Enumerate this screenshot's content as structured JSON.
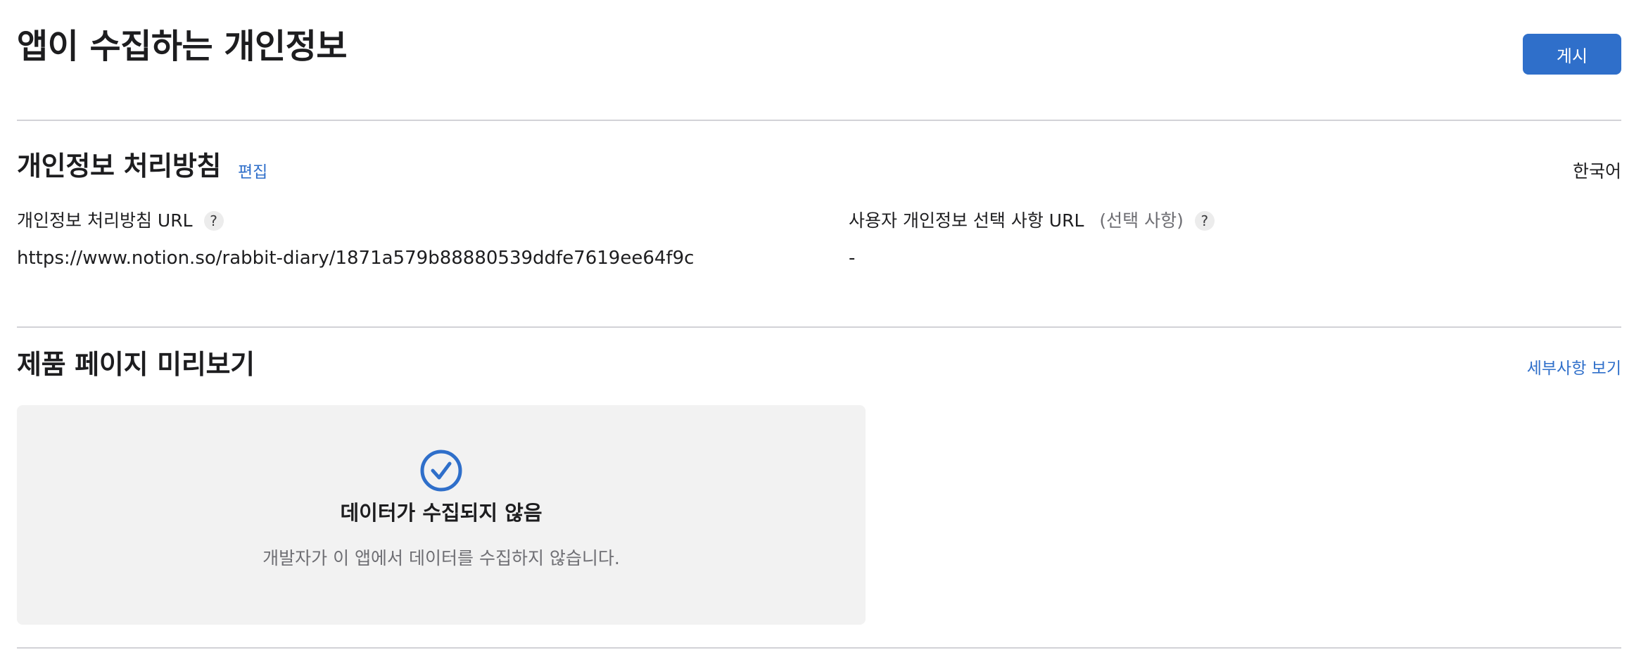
{
  "header": {
    "title": "앱이 수집하는 개인정보",
    "publish_label": "게시"
  },
  "privacy_policy": {
    "title": "개인정보 처리방침",
    "edit_label": "편집",
    "language": "한국어",
    "policy_url": {
      "label": "개인정보 처리방침 URL",
      "help": "?",
      "value": "https://www.notion.so/rabbit-diary/1871a579b88880539ddfe7619ee64f9c"
    },
    "choices_url": {
      "label": "사용자 개인정보 선택 사항 URL",
      "optional": "(선택 사항)",
      "help": "?",
      "value": "-"
    }
  },
  "preview": {
    "title": "제품 페이지 미리보기",
    "details_label": "세부사항 보기",
    "card": {
      "icon": "checkmark-circle-icon",
      "heading": "데이터가 수집되지 않음",
      "description": "개발자가 이 앱에서 데이터를 수집하지 않습니다."
    }
  },
  "colors": {
    "accent": "#2f6fca",
    "divider": "#d2d2d7",
    "card_bg": "#f2f2f2",
    "secondary_text": "#6e6e73"
  }
}
